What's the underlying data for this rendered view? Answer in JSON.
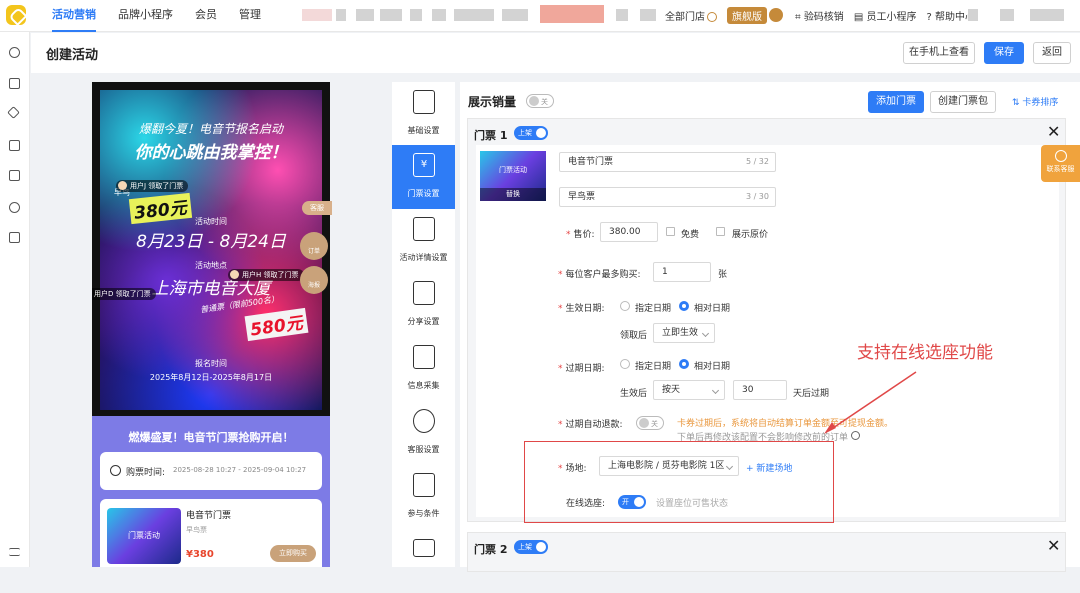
{
  "topnav": {
    "items": [
      "活动营销",
      "品牌小程序",
      "会员",
      "管理"
    ],
    "right": {
      "all_stores": "全部门店",
      "edition": "旗舰版",
      "verify": "验码核销",
      "staff_app": "员工小程序",
      "help": "帮助中心"
    }
  },
  "header": {
    "title": "创建活动",
    "preview_phone": "在手机上查看",
    "save": "保存",
    "back": "返回"
  },
  "poster": {
    "line1": "爆翻今夏！电音节报名启动",
    "line2": "你的心跳由我掌控！",
    "early_label": "早鸟",
    "early_price": "380元",
    "time_label": "活动时间",
    "time_value": "8月23日 - 8月24日",
    "place_label": "活动地点",
    "place_value": "上海市电音大厦",
    "normal_label": "普通票（限前500名）",
    "normal_price": "580元",
    "signup_label": "报名时间",
    "signup_value": "2025年8月12日-2025年8月17日",
    "ribbon1": "用户J 领取了门票",
    "ribbon2": "用户H 领取了门票",
    "ribbon3": "用户D 领取了门票",
    "kefu": "客服",
    "order": "订单",
    "poster_btn": "海报"
  },
  "lower": {
    "headline": "燃爆盛夏！电音节门票抢购开启！",
    "buy_time_label": "购票时间:",
    "buy_time_value": "2025-08-28 10:27 - 2025-09-04 10:27",
    "ticket_name": "电音节门票",
    "ticket_sub": "早鸟票",
    "ticket_price": "¥380",
    "buy_now": "立即购买",
    "thumb_text": "门票活动"
  },
  "steps": [
    {
      "label": "基础设置",
      "icon": "basic-settings-icon"
    },
    {
      "label": "门票设置",
      "icon": "ticket-icon"
    },
    {
      "label": "活动详情设置",
      "icon": "detail-icon"
    },
    {
      "label": "分享设置",
      "icon": "share-icon"
    },
    {
      "label": "信息采集",
      "icon": "form-icon"
    },
    {
      "label": "客服设置",
      "icon": "headset-icon"
    },
    {
      "label": "参与条件",
      "icon": "flag-icon"
    }
  ],
  "form": {
    "show_sales": "展示销量",
    "show_sales_toggle": "关",
    "add_ticket": "添加门票",
    "create_pack": "创建门票包",
    "sort": "卡券排序"
  },
  "ticket1": {
    "title": "门票 1",
    "status": "上架",
    "thumb_replace": "替换",
    "thumb_text": "门票活动",
    "name_value": "电音节门票",
    "name_count": "5 / 32",
    "sub_value": "早鸟票",
    "sub_count": "3 / 30",
    "price_label": "售价:",
    "price_value": "380.00",
    "free_label": "免费",
    "show_original_label": "展示原价",
    "limit_label": "每位客户最多购买:",
    "limit_value": "1",
    "limit_unit": "张",
    "effective_label": "生效日期:",
    "opt_fixed": "指定日期",
    "opt_relative": "相对日期",
    "claim_after": "领取后",
    "claim_select": "立即生效",
    "expire_label": "过期日期:",
    "effective_after": "生效后",
    "per_select": "按天",
    "days_value": "30",
    "days_suffix": "天后过期",
    "auto_refund_label": "过期自动退款:",
    "auto_refund_toggle": "关",
    "refund_note1": "卡券过期后，系统将自动结算订单金额至可提现金额。",
    "refund_note2": "下单后再修改该配置不会影响修改前的订单",
    "venue_label": "场地:",
    "venue_value": "上海电影院 / 觅芬电影院 1区",
    "new_venue": "新建场地",
    "online_seat_label": "在线选座:",
    "online_seat_toggle": "开",
    "seat_status": "设置座位可售状态"
  },
  "ticket2": {
    "title": "门票 2",
    "status": "上架"
  },
  "annotation": "支持在线选座功能",
  "lianxi": "联系客服"
}
